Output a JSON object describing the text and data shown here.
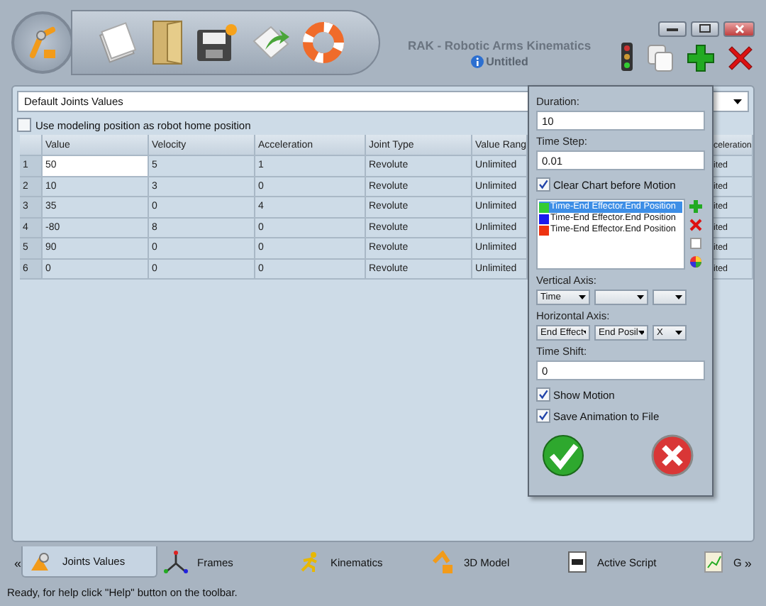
{
  "window": {
    "title": "RAK - Robotic Arms Kinematics",
    "document": "Untitled"
  },
  "joint_set": {
    "value": "Default Joints Values"
  },
  "home_option": {
    "label": "Use modeling position as robot home position",
    "checked": false
  },
  "table": {
    "columns": [
      "Value",
      "Velocity",
      "Acceleration",
      "Joint Type",
      "Value Rang",
      "celeration"
    ],
    "rows": [
      {
        "index": "1",
        "editing": true,
        "cells": [
          "50",
          "5",
          "1",
          "Revolute",
          "Unlimited",
          "ited"
        ]
      },
      {
        "index": "2",
        "editing": false,
        "cells": [
          "10",
          "3",
          "0",
          "Revolute",
          "Unlimited",
          "ited"
        ]
      },
      {
        "index": "3",
        "editing": false,
        "cells": [
          "35",
          "0",
          "4",
          "Revolute",
          "Unlimited",
          "ited"
        ]
      },
      {
        "index": "4",
        "editing": false,
        "cells": [
          "-80",
          "8",
          "0",
          "Revolute",
          "Unlimited",
          "ited"
        ]
      },
      {
        "index": "5",
        "editing": false,
        "cells": [
          "90",
          "0",
          "0",
          "Revolute",
          "Unlimited",
          "ited"
        ]
      },
      {
        "index": "6",
        "editing": false,
        "cells": [
          "0",
          "0",
          "0",
          "Revolute",
          "Unlimited",
          "ited"
        ]
      }
    ]
  },
  "motion_panel": {
    "duration": {
      "label": "Duration:",
      "value": "10"
    },
    "time_step": {
      "label": "Time Step:",
      "value": "0.01"
    },
    "clear_chart": {
      "label": "Clear Chart before Motion",
      "checked": true
    },
    "series": [
      {
        "label": "Time-End Effector.End Position",
        "color": "#33cc33",
        "selected": true
      },
      {
        "label": "Time-End Effector.End Position",
        "color": "#1a1aee",
        "selected": false
      },
      {
        "label": "Time-End Effector.End Position",
        "color": "#ee3311",
        "selected": false
      }
    ],
    "vertical_axis": {
      "label": "Vertical Axis:",
      "selects": [
        {
          "kind": "dropdown",
          "value": "Time"
        },
        {
          "kind": "dropdown"
        },
        {
          "kind": "dropdown"
        }
      ]
    },
    "horizontal_axis": {
      "label": "Horizontal Axis:",
      "selects": [
        {
          "kind": "dropdown",
          "value": "End Effect"
        },
        {
          "kind": "dropdown",
          "value": "End Posil"
        },
        {
          "kind": "dropdown",
          "value": "X"
        }
      ]
    },
    "time_shift": {
      "label": "Time Shift:",
      "value": "0"
    },
    "show_motion": {
      "label": "Show Motion",
      "checked": true
    },
    "save_animation": {
      "label": "Save Animation to File",
      "checked": true
    }
  },
  "tabs": {
    "scroll_left": "«",
    "scroll_right": "»",
    "items": [
      {
        "label": "Joints Values",
        "selected": true
      },
      {
        "label": "Frames",
        "selected": false
      },
      {
        "label": "Kinematics",
        "selected": false
      },
      {
        "label": "3D Model",
        "selected": false
      },
      {
        "label": "Active Script",
        "selected": false
      },
      {
        "label": "G",
        "selected": false
      }
    ]
  },
  "status_bar": "Ready, for help click \"Help\" button on the toolbar."
}
